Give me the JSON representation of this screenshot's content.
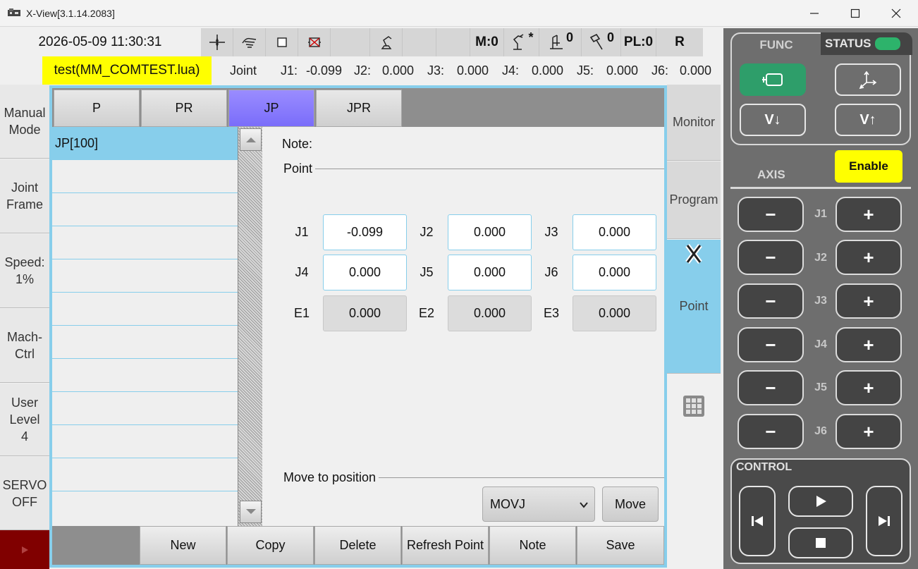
{
  "window": {
    "title": "X-View[3.1.14.2083]"
  },
  "header": {
    "datetime": "2026-05-09 11:30:31",
    "toolbar": {
      "mode_counter": "M:0",
      "tool_star": "*",
      "base_count": "0",
      "tool_count": "0",
      "payload": "PL:0",
      "r_label": "R"
    },
    "program_file": "test(MM_COMTEST.lua)",
    "joint_readout": {
      "label": "Joint",
      "j1_label": "J1:",
      "j1": "-0.099",
      "j2_label": "J2:",
      "j2": "0.000",
      "j3_label": "J3:",
      "j3": "0.000",
      "j4_label": "J4:",
      "j4": "0.000",
      "j5_label": "J5:",
      "j5": "0.000",
      "j6_label": "J6:",
      "j6": "0.000"
    }
  },
  "left_sidebar": {
    "manual_mode": "Manual Mode",
    "joint_frame": "Joint Frame",
    "speed": "Speed: 1%",
    "mach_ctrl": "Mach- Ctrl",
    "user_level": "User Level 4",
    "servo": "SERVO OFF"
  },
  "tabs": [
    {
      "label": "P"
    },
    {
      "label": "PR"
    },
    {
      "label": "JP"
    },
    {
      "label": "JPR"
    }
  ],
  "active_tab": "JP",
  "point_list": {
    "items": [
      "JP[100]"
    ],
    "selected": "JP[100]"
  },
  "details": {
    "note_label": "Note:",
    "point_section": "Point",
    "axes": [
      {
        "label": "J1",
        "value": "-0.099",
        "editable": true
      },
      {
        "label": "J2",
        "value": "0.000",
        "editable": true
      },
      {
        "label": "J3",
        "value": "0.000",
        "editable": true
      },
      {
        "label": "J4",
        "value": "0.000",
        "editable": true
      },
      {
        "label": "J5",
        "value": "0.000",
        "editable": true
      },
      {
        "label": "J6",
        "value": "0.000",
        "editable": true
      },
      {
        "label": "E1",
        "value": "0.000",
        "editable": false
      },
      {
        "label": "E2",
        "value": "0.000",
        "editable": false
      },
      {
        "label": "E3",
        "value": "0.000",
        "editable": false
      }
    ],
    "move_section": "Move to position",
    "move_type": "MOVJ",
    "move_button": "Move"
  },
  "bottom_buttons": {
    "new": "New",
    "copy": "Copy",
    "delete": "Delete",
    "refresh": "Refresh Point",
    "note": "Note",
    "save": "Save"
  },
  "side_nav": {
    "monitor": "Monitor",
    "program": "Program",
    "point": "Point"
  },
  "control_panel": {
    "func_label": "FUNC",
    "status_label": "STATUS",
    "speed_down": "V↓",
    "speed_up": "V↑",
    "axis_label": "AXIS",
    "enable": "Enable",
    "jog_axes": [
      "J1",
      "J2",
      "J3",
      "J4",
      "J5",
      "J6"
    ],
    "minus": "−",
    "plus": "+",
    "control_label": "CONTROL"
  },
  "colors": {
    "accent_blue": "#87ceeb",
    "active_tab": "#7a6dfa",
    "highlight_yellow": "#ffff00",
    "status_green": "#2db36b",
    "servo_red": "#800000"
  }
}
